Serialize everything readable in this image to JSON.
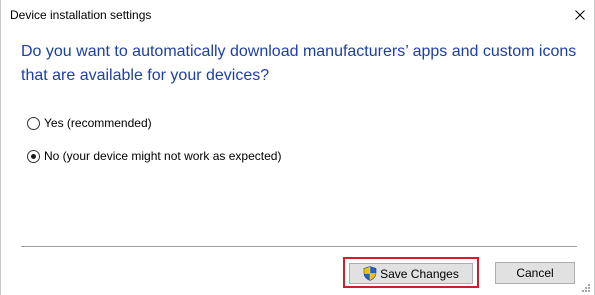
{
  "window": {
    "title": "Device installation settings",
    "close_icon": "close-icon"
  },
  "question": {
    "line1": "Do you want to automatically download manufacturers’ apps and custom icons",
    "line2": "that are available for your devices?",
    "color": "#1c3ea8"
  },
  "options": {
    "yes": {
      "label": "Yes (recommended)",
      "selected": false
    },
    "no": {
      "label": "No (your device might not work as expected)",
      "selected": true
    }
  },
  "buttons": {
    "save_label": "Save Changes",
    "save_icon": "uac-shield-icon",
    "cancel_label": "Cancel"
  },
  "highlight_color": "#d21d26"
}
